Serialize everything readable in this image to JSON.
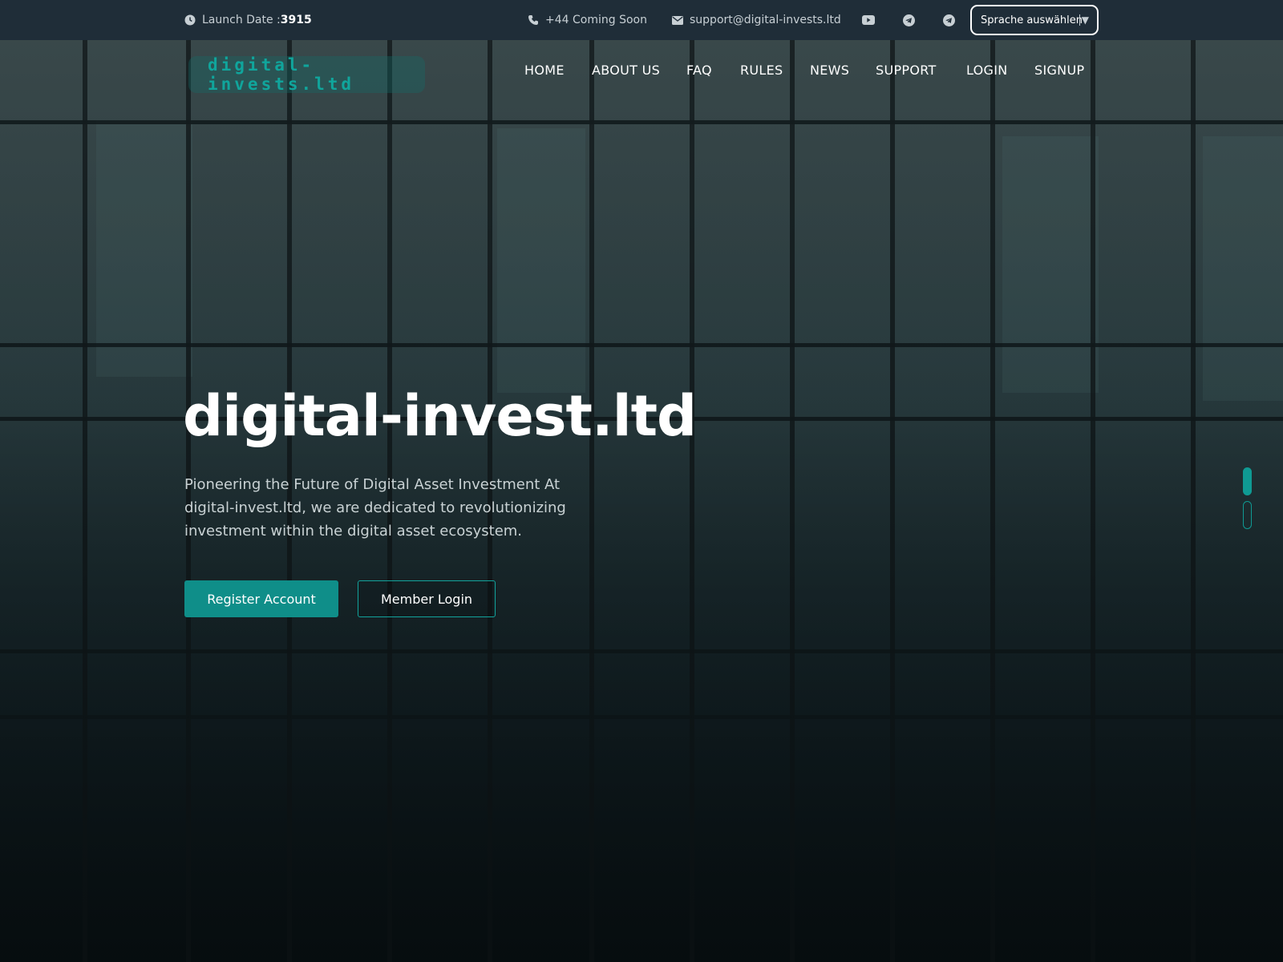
{
  "topbar": {
    "launch_label": "Launch Date :",
    "launch_value": "3915",
    "phone": "+44 Coming Soon",
    "email": "support@digital-invests.ltd",
    "social_icons": [
      "youtube-icon",
      "telegram-icon",
      "telegram-icon"
    ],
    "language_select": "Sprache auswählen"
  },
  "nav": {
    "logo": "digital-invests.ltd",
    "items": [
      "HOME",
      "ABOUT US",
      "FAQ",
      "RULES",
      "NEWS",
      "SUPPORT",
      "LOGIN",
      "SIGNUP"
    ]
  },
  "hero": {
    "title": "digital-invest.ltd",
    "text": "Pioneering the Future of Digital Asset Investment At digital-invest.ltd, we are dedicated to revolutionizing investment within the digital asset ecosystem.",
    "primary_button": "Register Account",
    "secondary_button": "Member Login"
  },
  "colors": {
    "accent": "#0f8e89",
    "topbar_bg": "#1f2d38",
    "logo_text": "#10a59c"
  }
}
